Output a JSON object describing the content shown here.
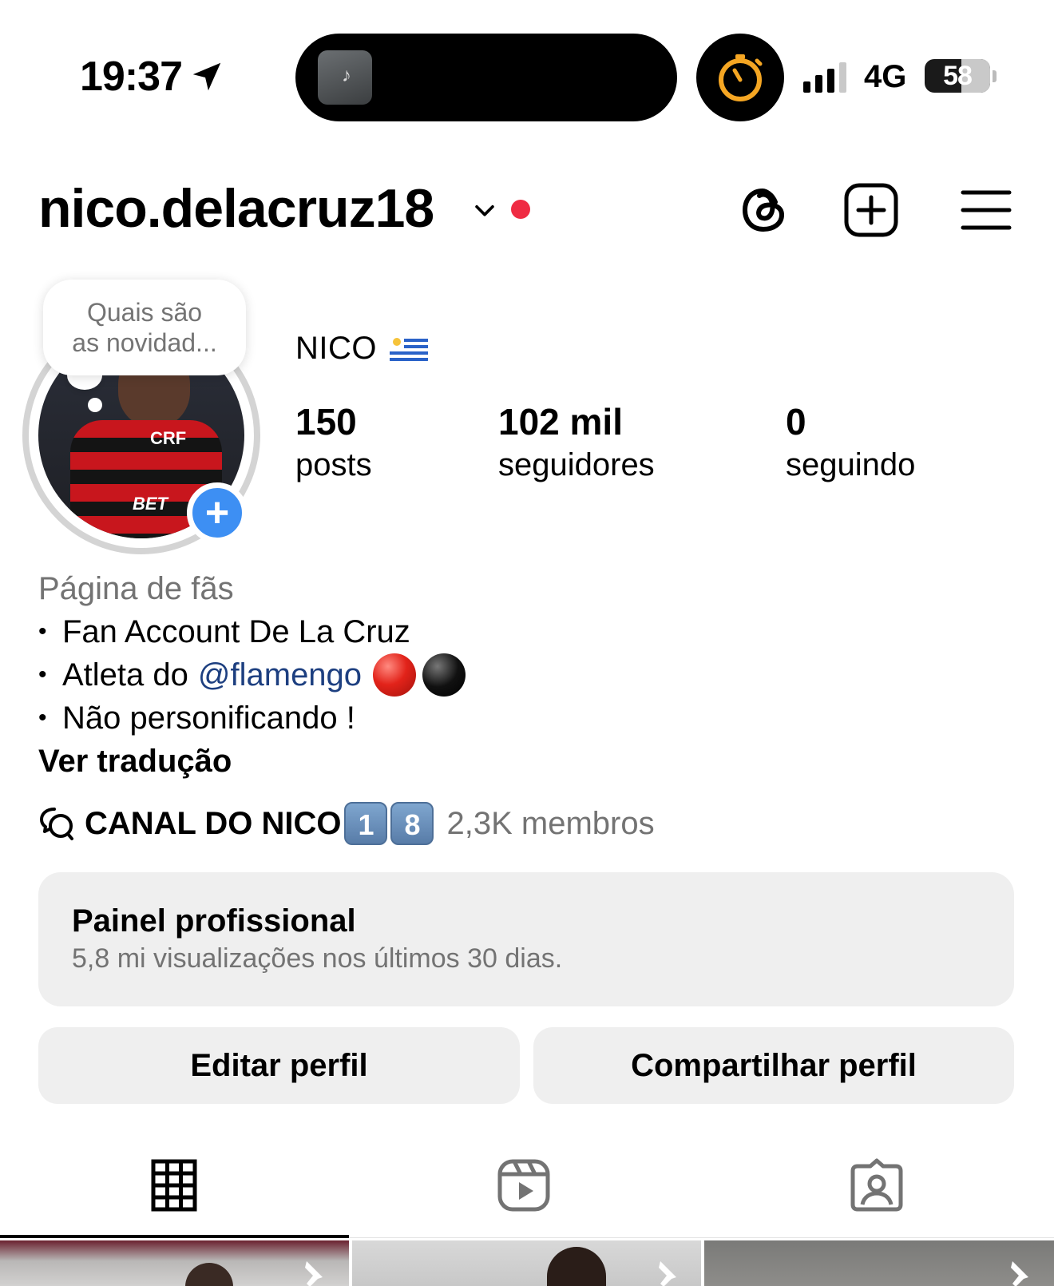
{
  "status_bar": {
    "time": "19:37",
    "network": "4G",
    "battery": "58",
    "battery_level": 0.58,
    "signal_bars": 3
  },
  "header": {
    "username": "nico.delacruz18",
    "has_notification_dot": true,
    "icons": [
      "threads-icon",
      "create-post-icon",
      "menu-icon"
    ]
  },
  "note": {
    "text_line1": "Quais são",
    "text_line2": "as novidad..."
  },
  "profile": {
    "display_name": "NICO",
    "name_flag": "uruguay-flag-icon",
    "stats": [
      {
        "value": "150",
        "label": "posts"
      },
      {
        "value": "102 mil",
        "label": "seguidores"
      },
      {
        "value": "0",
        "label": "seguindo"
      }
    ]
  },
  "bio": {
    "category": "Página de fãs",
    "line1": "Fan Account De La Cruz",
    "line2_prefix": "Atleta do",
    "line2_mention": "@flamengo",
    "line3": "Não personificando !",
    "bullet": "•",
    "translate": "Ver tradução"
  },
  "channel": {
    "name": "CANAL DO NICO",
    "keycap1": "1",
    "keycap2": "8",
    "members": "2,3K membros"
  },
  "dashboard": {
    "title": "Painel profissional",
    "subtitle": "5,8 mi visualizações nos últimos 30 dias."
  },
  "actions": {
    "edit": "Editar perfil",
    "share": "Compartilhar perfil"
  },
  "tabs": [
    "grid-icon",
    "reels-icon",
    "tagged-icon"
  ],
  "colors": {
    "accent_blue": "#3d8ff3",
    "mention": "#1d3f80",
    "notification_red": "#ef2b43",
    "timer_orange": "#f5a623",
    "secondary_text": "#737373",
    "button_bg": "#efefef"
  }
}
